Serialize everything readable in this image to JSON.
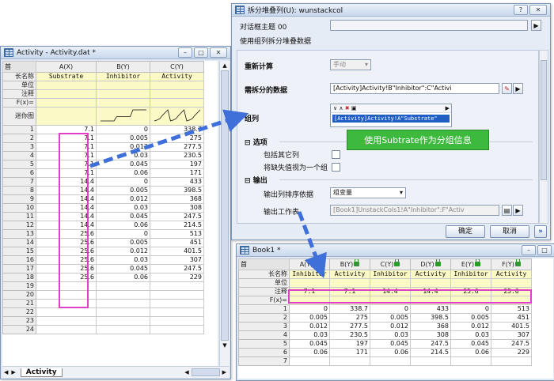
{
  "activity_window": {
    "title": "Activity - Activity.dat *",
    "col_headers": [
      "A(X)",
      "B(Y)",
      "C(Y)"
    ],
    "meta_rows": [
      {
        "label": "长名称",
        "values": [
          "Substrate",
          "Inhibitor",
          "Activity"
        ]
      },
      {
        "label": "单位",
        "values": [
          "",
          "",
          ""
        ]
      },
      {
        "label": "注释",
        "values": [
          "",
          "",
          ""
        ]
      },
      {
        "label": "F(x)=",
        "values": [
          "",
          "",
          ""
        ]
      },
      {
        "label": "迷你图",
        "values": [
          "",
          "",
          ""
        ]
      }
    ],
    "rows": [
      [
        "1",
        "7.1",
        "0",
        "338.7"
      ],
      [
        "2",
        "7.1",
        "0.005",
        "275"
      ],
      [
        "3",
        "7.1",
        "0.012",
        "277.5"
      ],
      [
        "4",
        "7.1",
        "0.03",
        "230.5"
      ],
      [
        "5",
        "7.1",
        "0.045",
        "197"
      ],
      [
        "6",
        "7.1",
        "0.06",
        "171"
      ],
      [
        "7",
        "14.4",
        "0",
        "433"
      ],
      [
        "8",
        "14.4",
        "0.005",
        "398.5"
      ],
      [
        "9",
        "14.4",
        "0.012",
        "368"
      ],
      [
        "10",
        "14.4",
        "0.03",
        "308"
      ],
      [
        "11",
        "14.4",
        "0.045",
        "247.5"
      ],
      [
        "12",
        "14.4",
        "0.06",
        "214.5"
      ],
      [
        "13",
        "25.6",
        "0",
        "513"
      ],
      [
        "14",
        "25.6",
        "0.005",
        "451"
      ],
      [
        "15",
        "25.6",
        "0.012",
        "401.5"
      ],
      [
        "16",
        "25.6",
        "0.03",
        "307"
      ],
      [
        "17",
        "25.6",
        "0.045",
        "247.5"
      ],
      [
        "18",
        "25.6",
        "0.06",
        "229"
      ],
      [
        "19",
        "",
        "",
        ""
      ],
      [
        "20",
        "",
        "",
        ""
      ],
      [
        "21",
        "",
        "",
        ""
      ],
      [
        "22",
        "",
        "",
        ""
      ],
      [
        "23",
        "",
        "",
        ""
      ],
      [
        "24",
        "",
        "",
        ""
      ]
    ],
    "sheet_tab": "Activity"
  },
  "dialog": {
    "title": "拆分堆叠列(U): wunstackcol",
    "theme_label": "对话框主题",
    "theme_value": "00",
    "description": "使用组列拆分堆叠数据",
    "recalc_label": "重新计算",
    "recalc_value": "手动",
    "input_label": "需拆分的数据",
    "input_value": "[Activity]Activity!B\"Inhibitor\":C\"Activi",
    "group_label": "组列",
    "group_value": "[Activity]Activity!A\"Substrate\"",
    "options_label": "选项",
    "include_other_label": "包括其它列",
    "missing_as_group_label": "将缺失值视为一个组",
    "output_label": "输出",
    "sort_label": "输出列排序依据",
    "sort_value": "组变量",
    "output_sheet_label": "输出工作表",
    "output_sheet_value": "[Book1]UnstackCols1!A\"Inhibitor\":F\"Activ",
    "ok_label": "确定",
    "cancel_label": "取消",
    "expand_label": "»",
    "help_label": "?"
  },
  "callout": {
    "text": "使用Subtrate作为分组信息"
  },
  "book_window": {
    "title": "Book1 *",
    "col_headers": [
      "A(Y)",
      "B(Y)",
      "C(Y)",
      "D(Y)",
      "E(Y)",
      "F(Y)"
    ],
    "meta_rows": [
      {
        "label": "长名称",
        "values": [
          "Inhibitor",
          "Activity",
          "Inhibitor",
          "Activity",
          "Inhibitor",
          "Activity"
        ]
      },
      {
        "label": "单位",
        "values": [
          "",
          "",
          "",
          "",
          "",
          ""
        ]
      },
      {
        "label": "注释",
        "values": [
          "7.1",
          "7.1",
          "14.4",
          "14.4",
          "25.6",
          "25.6"
        ]
      },
      {
        "label": "F(x)=",
        "values": [
          "",
          "",
          "",
          "",
          "",
          ""
        ]
      }
    ],
    "rows": [
      [
        "1",
        "0",
        "338.7",
        "0",
        "433",
        "0",
        "513"
      ],
      [
        "2",
        "0.005",
        "275",
        "0.005",
        "398.5",
        "0.005",
        "451"
      ],
      [
        "3",
        "0.012",
        "277.5",
        "0.012",
        "368",
        "0.012",
        "401.5"
      ],
      [
        "4",
        "0.03",
        "230.5",
        "0.03",
        "308",
        "0.03",
        "307"
      ],
      [
        "5",
        "0.045",
        "197",
        "0.045",
        "247.5",
        "0.045",
        "247.5"
      ],
      [
        "6",
        "0.06",
        "171",
        "0.06",
        "214.5",
        "0.06",
        "229"
      ],
      [
        "7",
        "",
        "",
        "",
        "",
        "",
        ""
      ]
    ]
  },
  "colors": {
    "highlight": "#e040c8",
    "arrow": "#3f6fd8",
    "callout_bg": "#3dba3d",
    "meta_bg": "#fbf9c6"
  }
}
